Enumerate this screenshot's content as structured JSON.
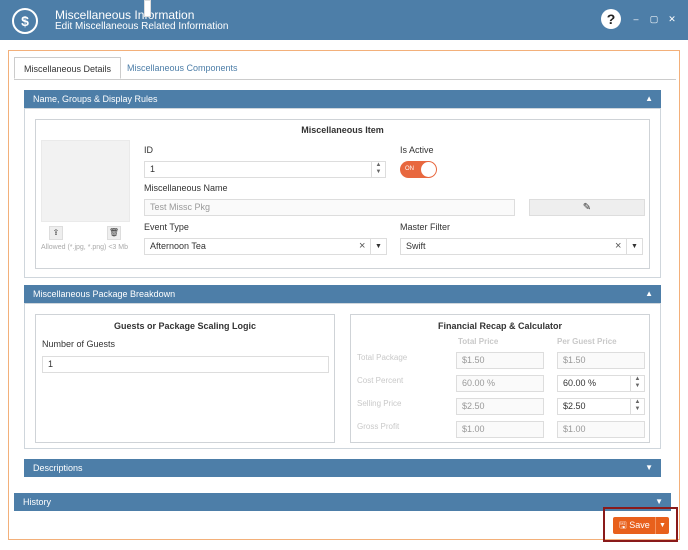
{
  "window": {
    "title": "Miscellaneous Information",
    "subtitle": "Edit Miscellaneous Related Information",
    "logo_glyph": "$",
    "help_glyph": "?",
    "minimize_glyph": "–",
    "maximize_glyph": "▢",
    "close_glyph": "✕"
  },
  "tabs": [
    {
      "label": "Miscellaneous Details",
      "active": true
    },
    {
      "label": "Miscellaneous Components",
      "active": false
    }
  ],
  "sections": {
    "name_groups": {
      "title": "Name, Groups & Display Rules",
      "expanded": true
    },
    "breakdown": {
      "title": "Miscellaneous Package Breakdown",
      "expanded": true
    },
    "descriptions": {
      "title": "Descriptions",
      "expanded": false
    },
    "history": {
      "title": "History",
      "expanded": false
    }
  },
  "item": {
    "box_title": "Miscellaneous Item",
    "id_label": "ID",
    "id_value": "1",
    "is_active_label": "Is Active",
    "is_active_text": "ON",
    "is_active": true,
    "name_label": "Miscellaneous Name",
    "name_value": "Test Missc Pkg",
    "event_type_label": "Event Type",
    "event_type_value": "Afternoon Tea",
    "master_filter_label": "Master Filter",
    "master_filter_value": "Swift",
    "image_hint": "Allowed (*.jpg, *.png) <3 Mb",
    "edit_icon": "pencil-icon",
    "upload_icon": "upload-icon",
    "delete_icon": "trash-icon"
  },
  "scaling": {
    "box_title": "Guests or Package Scaling Logic",
    "guests_label": "Number of Guests",
    "guests_value": "1"
  },
  "recap": {
    "box_title": "Financial Recap & Calculator",
    "col_total": "Total Price",
    "col_per_guest": "Per Guest Price",
    "rows": [
      {
        "label": "Total Package",
        "total": "$1.50",
        "per_guest": "$1.50",
        "per_guest_editable": false
      },
      {
        "label": "Cost Percent",
        "total": "60.00 %",
        "per_guest": "60.00 %",
        "per_guest_editable": true
      },
      {
        "label": "Selling Price",
        "total": "$2.50",
        "per_guest": "$2.50",
        "per_guest_editable": true
      },
      {
        "label": "Gross Profit",
        "total": "$1.00",
        "per_guest": "$1.00",
        "per_guest_editable": false
      }
    ]
  },
  "footer": {
    "save_label": "Save",
    "save_icon": "floppy-disk-icon"
  },
  "colors": {
    "header_blue": "#4d7ea8",
    "accent_orange": "#e8601c",
    "toggle_on": "#e8683f",
    "highlight": "#8a1a1a"
  }
}
